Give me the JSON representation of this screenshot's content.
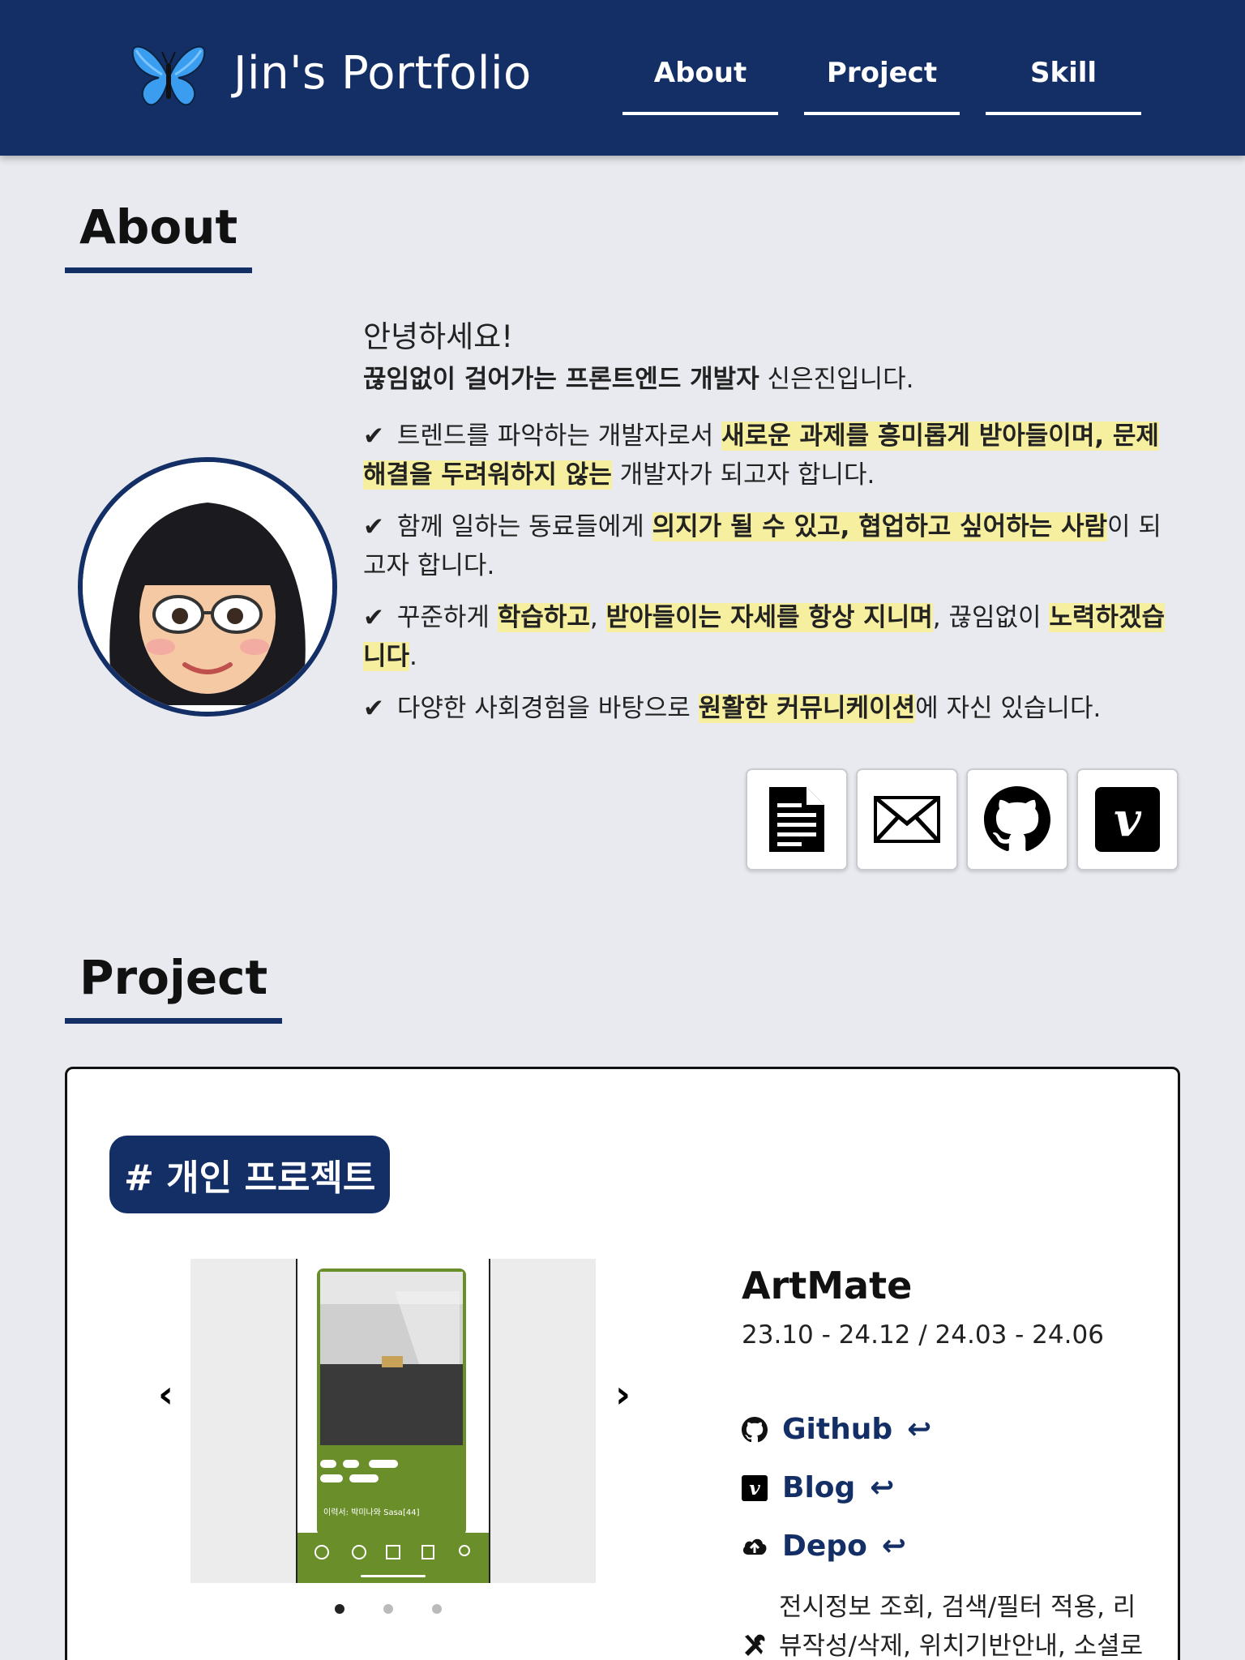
{
  "header": {
    "brand": "Jin's Portfolio",
    "nav": {
      "about": "About",
      "project": "Project",
      "skill": "Skill"
    },
    "logo_icon": "butterfly-icon"
  },
  "about": {
    "title": "About",
    "hello": "안녕하세요!",
    "lead_bold": "끊임없이 걸어가는 프론트엔드 개발자",
    "lead_rest": " 신은진입니다.",
    "points": [
      {
        "check": "✔",
        "t1": " 트렌드를 파악하는 개발자로서 ",
        "h1": "새로운 과제를 흥미롭게 받아들이며, 문제 해결을 두려워하지 않는",
        "t2": " 개발자가 되고자 합니다."
      },
      {
        "check": "✔",
        "t1": " 함께 일하는 동료들에게 ",
        "h1": "의지가 될 수 있고, 협업하고 싶어하는 사람",
        "t2": "이 되고자 합니다."
      },
      {
        "check": "✔",
        "t1": " 꾸준하게 ",
        "h1": "학습하고",
        "t2": ", ",
        "h2": "받아들이는 자세를 항상 지니며",
        "t3": ", 끊임없이 ",
        "h3": "노력하겠습니다",
        "t4": "."
      },
      {
        "check": "✔",
        "t1": " 다양한 사회경험을 바탕으로 ",
        "h1": "원활한 커뮤니케이션",
        "t2": "에 자신 있습니다."
      }
    ],
    "contacts": [
      "document-icon",
      "mail-icon",
      "github-icon",
      "vimeo-icon"
    ],
    "accent": "#132f66",
    "highlight": "#f6efa0"
  },
  "project": {
    "title": "Project",
    "tag": "# 개인 프로젝트",
    "name": "ArtMate",
    "date": "23.10 - 24.12 / 24.03 - 24.06",
    "links": {
      "github": "Github",
      "blog": "Blog",
      "depo": "Depo"
    },
    "return_glyph": "↩",
    "features": "전시정보 조회, 검색/필터 적용, 리뷰작성/삭제, 위치기반안내, 소셜로",
    "screen": {
      "chips": [
        "#회화",
        "# 입체",
        "# 아카이브",
        "# 사운드",
        "# 영상 등"
      ],
      "caption": "이력서: 박미나와 Sasa[44]"
    },
    "carousel_dots": 3,
    "active_dot": 0
  }
}
